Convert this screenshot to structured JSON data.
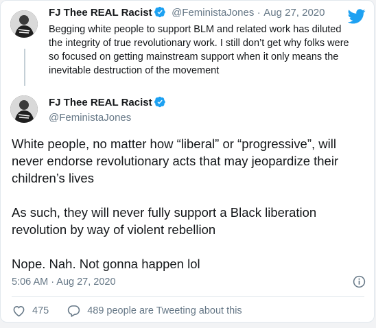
{
  "quoted_tweet": {
    "author_name": "FJ Thee REAL Racist",
    "handle": "@FeministaJones",
    "separator": "·",
    "date": "Aug 27, 2020",
    "text": "Begging white people to support BLM and related work has diluted the integrity of true revolutionary work. I still don’t get why folks were so focused on getting mainstream support when it only means the inevitable destruction of the movement"
  },
  "main_tweet": {
    "author_name": "FJ Thee REAL Racist",
    "handle": "@FeministaJones",
    "paragraphs": [
      "White people, no matter how “liberal” or “progressive”, will never endorse revolutionary acts that may jeopardize their children’s lives",
      "As such, they will never fully support a Black liberation revolution by way of violent rebellion",
      "Nope. Nah. Not gonna happen lol"
    ],
    "timestamp": "5:06 AM · Aug 27, 2020"
  },
  "actions": {
    "like_count": "475",
    "discussion_label": "489 people are Tweeting about this"
  },
  "icons": {
    "verified": "verified-badge-icon",
    "logo": "twitter-bird-icon",
    "info": "info-icon",
    "like": "heart-icon",
    "reply": "speech-bubble-icon"
  },
  "colors": {
    "brand": "#1da1f2",
    "text": "#14171a",
    "muted": "#657786",
    "border": "#e1e8ed"
  }
}
